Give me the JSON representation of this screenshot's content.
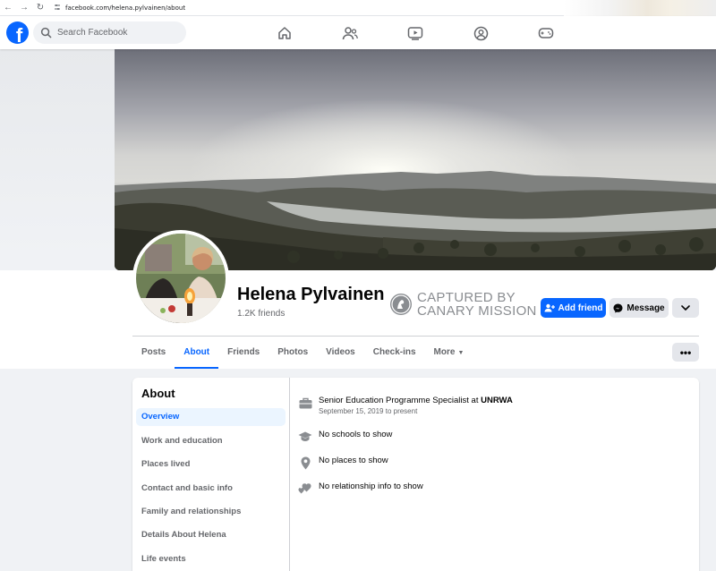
{
  "browser": {
    "url": "facebook.com/helena.pylvainen/about",
    "back": "←",
    "forward": "→",
    "reload": "↻"
  },
  "topnav": {
    "logo_letter": "f",
    "search_placeholder": "Search Facebook",
    "icons": [
      "home-icon",
      "friends-icon",
      "video-icon",
      "groups-icon",
      "gaming-icon"
    ]
  },
  "profile": {
    "name": "Helena Pylvainen",
    "friends": "1.2K friends",
    "watermark_line1": "CAPTURED BY",
    "watermark_line2": "CANARY MISSION",
    "add_friend": "Add friend",
    "message": "Message",
    "dropdown": "⌄"
  },
  "tabs": {
    "items": [
      {
        "label": "Posts"
      },
      {
        "label": "About"
      },
      {
        "label": "Friends"
      },
      {
        "label": "Photos"
      },
      {
        "label": "Videos"
      },
      {
        "label": "Check-ins"
      },
      {
        "label": "More"
      }
    ],
    "active": "About",
    "more_caret": "▼",
    "dots": "•••"
  },
  "about": {
    "title": "About",
    "sidebar": [
      {
        "label": "Overview"
      },
      {
        "label": "Work and education"
      },
      {
        "label": "Places lived"
      },
      {
        "label": "Contact and basic info"
      },
      {
        "label": "Family and relationships"
      },
      {
        "label": "Details About Helena"
      },
      {
        "label": "Life events"
      }
    ],
    "work": {
      "prefix": "Senior Education Programme Specialist at ",
      "org": "UNRWA",
      "date": "September 15, 2019 to present"
    },
    "school": "No schools to show",
    "places": "No places to show",
    "relationship": "No relationship info to show"
  },
  "colors": {
    "brand_blue": "#0866ff",
    "background": "#f0f2f5",
    "secondary_text": "#65676b",
    "button_gray": "#e4e6eb"
  }
}
